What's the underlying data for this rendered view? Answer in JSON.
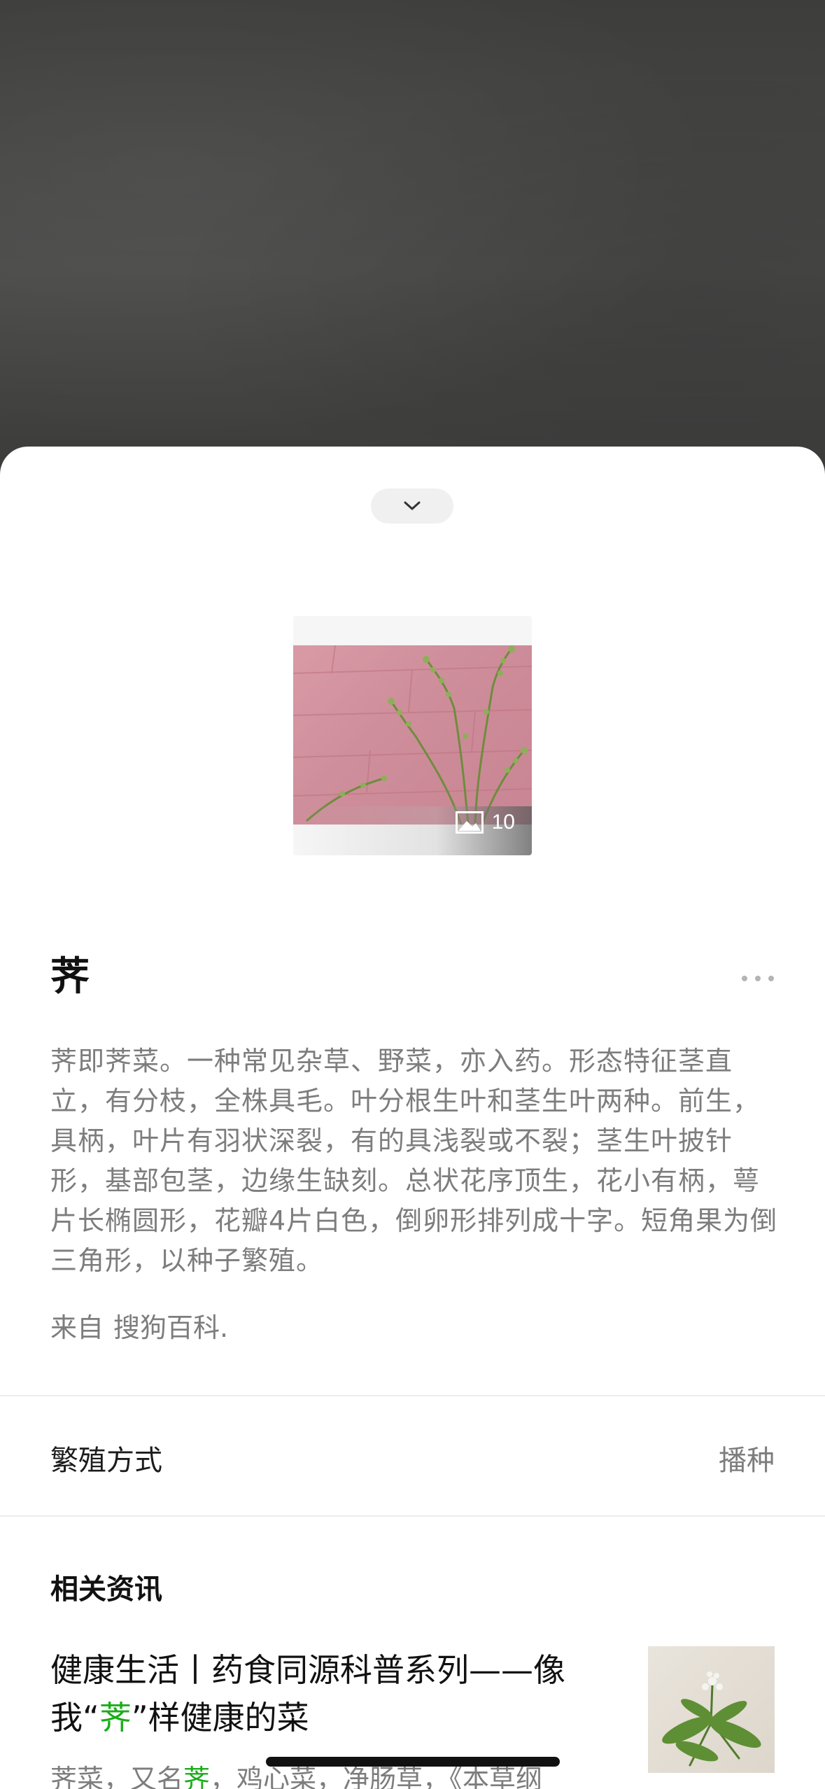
{
  "sheet": {
    "collapse_icon": "chevron-down-icon"
  },
  "gallery": {
    "photo_count": "10",
    "count_icon": "image-icon"
  },
  "entry": {
    "title": "荠",
    "more_icon": "more-dots-icon",
    "description": "荠即荠菜。一种常见杂草、野菜，亦入药。形态特征茎直立，有分枝，全株具毛。叶分根生叶和茎生叶两种。前生，具柄，叶片有羽状深裂，有的具浅裂或不裂；茎生叶披针形，基部包茎，边缘生缺刻。总状花序顶生，花小有柄，萼片长椭圆形，花瓣4片白色，倒卵形排列成十字。短角果为倒三角形，以种子繁殖。",
    "source_prefix": "来自",
    "source_name": "搜狗百科."
  },
  "attributes": {
    "label": "繁殖方式",
    "value": "播种"
  },
  "news": {
    "section_title": "相关资讯",
    "items": [
      {
        "title_before": "健康生活丨药食同源科普系列——像我“",
        "title_highlight": "荠",
        "title_after": "”样健康的菜",
        "snippet_before": "荠菜，又名",
        "snippet_highlight": "荠",
        "snippet_after": "，鸡心菜，净肠草，《本草纲"
      }
    ]
  },
  "colors": {
    "highlight": "#1aad19",
    "text_primary": "#111111",
    "text_secondary": "#7d7d7d"
  }
}
